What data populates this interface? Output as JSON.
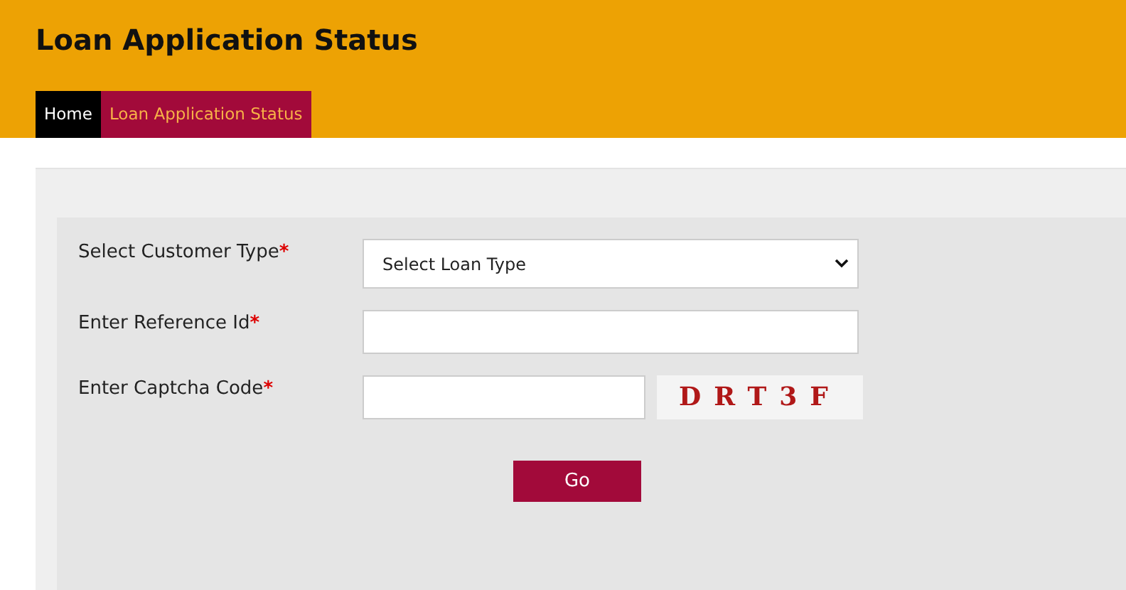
{
  "header": {
    "title": "Loan Application Status"
  },
  "nav": [
    {
      "label": "Home",
      "selected": false
    },
    {
      "label": "Loan Application Status",
      "selected": true
    }
  ],
  "form": {
    "fields": [
      {
        "kind": "select",
        "label": "Select Customer Type",
        "required": true,
        "value": "Select Loan Type"
      },
      {
        "kind": "text",
        "label": "Enter Reference Id",
        "required": true
      },
      {
        "kind": "captcha",
        "label": "Enter Captcha Code",
        "required": true,
        "code": "DRT3F"
      }
    ],
    "submit": "Go",
    "required_mark": "*"
  }
}
